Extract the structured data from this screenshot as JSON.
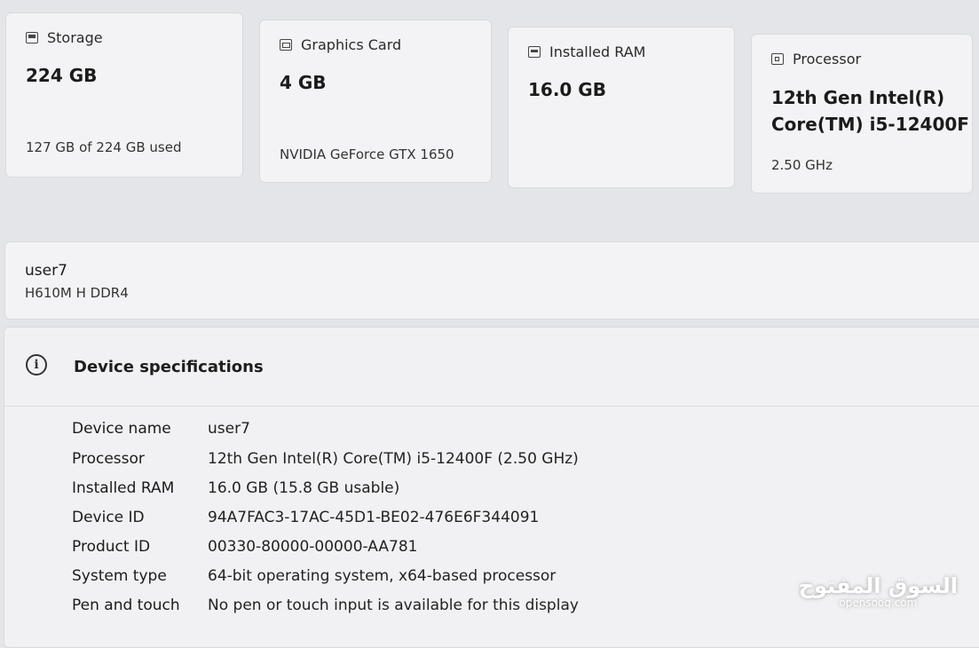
{
  "cards": [
    {
      "icon": "storage-icon",
      "label": "Storage",
      "value": "224 GB",
      "detail": "127 GB of 224 GB used"
    },
    {
      "icon": "graphics-card-icon",
      "label": "Graphics Card",
      "value": "4 GB",
      "detail": "NVIDIA GeForce GTX 1650"
    },
    {
      "icon": "ram-icon",
      "label": "Installed RAM",
      "value": "16.0 GB",
      "detail": ""
    },
    {
      "icon": "processor-icon",
      "label": "Processor",
      "value_line1": "12th Gen Intel(R)",
      "value_line2": "Core(TM) i5-12400F",
      "detail": "2.50 GHz"
    }
  ],
  "device": {
    "name": "user7",
    "model": "H610M H DDR4"
  },
  "specs": {
    "title": "Device specifications",
    "rows": [
      {
        "label": "Device name",
        "value": "user7"
      },
      {
        "label": "Processor",
        "value": "12th Gen Intel(R) Core(TM) i5-12400F (2.50 GHz)"
      },
      {
        "label": "Installed RAM",
        "value": "16.0 GB (15.8 GB usable)"
      },
      {
        "label": "Device ID",
        "value": "94A7FAC3-17AC-45D1-BE02-476E6F344091"
      },
      {
        "label": "Product ID",
        "value": "00330-80000-00000-AA781"
      },
      {
        "label": "System type",
        "value": "64-bit operating system, x64-based processor"
      },
      {
        "label": "Pen and touch",
        "value": "No pen or touch input is available for this display"
      }
    ]
  },
  "watermark": {
    "arabic": "السوق المفتوح",
    "latin": "opensooq.com"
  }
}
